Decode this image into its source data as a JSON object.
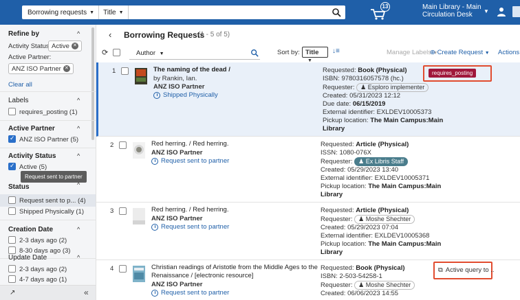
{
  "topbar": {
    "search_scope": "Borrowing requests",
    "search_field": "Title",
    "cart_count": "13",
    "location_line1": "Main Library - Main",
    "location_line2": "Circulation Desk"
  },
  "sidebar": {
    "refine_by": "Refine by",
    "activity_status_label": "Activity Status: ",
    "activity_status_chip": "Active",
    "active_partner_label": "Active Partner:",
    "active_partner_chip": "ANZ ISO Partner",
    "clear_all": "Clear all",
    "sections": {
      "labels": {
        "title": "Labels",
        "items": [
          "requires_posting (1)"
        ]
      },
      "active_partner": {
        "title": "Active Partner",
        "items": [
          "ANZ ISO Partner (5)"
        ]
      },
      "activity_status": {
        "title": "Activity Status",
        "items": [
          "Active (5)"
        ]
      },
      "status": {
        "title": "Status",
        "items": [
          "Request sent to p... (4)",
          "Shipped Physically (1)"
        ]
      },
      "creation_date": {
        "title": "Creation Date",
        "items": [
          "2-3 days ago (2)",
          "8-30 days ago (3)"
        ]
      },
      "update_date": {
        "title": "Update Date",
        "items": [
          "2-3 days ago (2)",
          "4-7 days ago (1)"
        ]
      }
    },
    "tooltip": "Request sent to partner"
  },
  "main": {
    "title": "Borrowing Requests",
    "count": "(1 - 5 of 5)",
    "toolbar": {
      "filter_field": "Author",
      "sort_by_label": "Sort by:",
      "sort_value": "Title",
      "manage_labels": "Manage Labels",
      "create_request": "Create Request",
      "actions": "Actions"
    },
    "rows": [
      {
        "num": "1",
        "title": "The naming of the dead /",
        "author": "by Rankin, Ian.",
        "partner": "ANZ ISO Partner",
        "status": "Shipped Physically",
        "requested_label": "Requested: ",
        "requested": "Book (Physical)",
        "id_line": "ISBN: 9780316057578 (hc.)",
        "requester_label": "Requester: ",
        "requester": "Esploro implementer",
        "created": "Created: 05/31/2023 12:12",
        "due_label": "Due date: ",
        "due": "06/15/2019",
        "external": "External identifier: EXLDEV10005373",
        "pickup_label": "Pickup location: ",
        "pickup1": "The Main Campus:Main",
        "pickup2": "Library",
        "tag": "requires_posting"
      },
      {
        "num": "2",
        "title": "Red herring. / Red herring.",
        "partner": "ANZ ISO Partner",
        "status": "Request sent to partner",
        "requested_label": "Requested: ",
        "requested": "Article (Physical)",
        "id_line": "ISSN: 1080-076X",
        "requester_label": "Requester: ",
        "requester": "Ex Libris Staff",
        "created": "Created: 05/29/2023 13:40",
        "external": "External identifier: EXLDEV10005371",
        "pickup_label": "Pickup location: ",
        "pickup1": "The Main Campus:Main",
        "pickup2": "Library"
      },
      {
        "num": "3",
        "title": "Red herring. / Red herring.",
        "partner": "ANZ ISO Partner",
        "status": "Request sent to partner",
        "requested_label": "Requested: ",
        "requested": "Article (Physical)",
        "requester_label": "Requester: ",
        "requester": "Moshe Shechter",
        "created": "Created: 05/29/2023 07:04",
        "external": "External identifier: EXLDEV10005368",
        "pickup_label": "Pickup location: ",
        "pickup1": "The Main Campus:Main",
        "pickup2": "Library"
      },
      {
        "num": "4",
        "title1": "Christian readings of Aristotle from the Middle Ages to the",
        "title2": "Renaissance / [electronic resource]",
        "partner": "ANZ ISO Partner",
        "status": "Request sent to partner",
        "requested_label": "Requested: ",
        "requested": "Book (Physical)",
        "id_line": "ISBN: 2-503-54258-1",
        "requester_label": "Requester: ",
        "requester": "Moshe Shechter",
        "created": "Created: 06/06/2023 14:55",
        "active_query": "Active query to .."
      }
    ]
  },
  "colors": {
    "topbar": "#1f5fa8",
    "accent": "#2a6fc9",
    "tag": "#a0173b",
    "highlight_frame": "#e14b2e"
  }
}
